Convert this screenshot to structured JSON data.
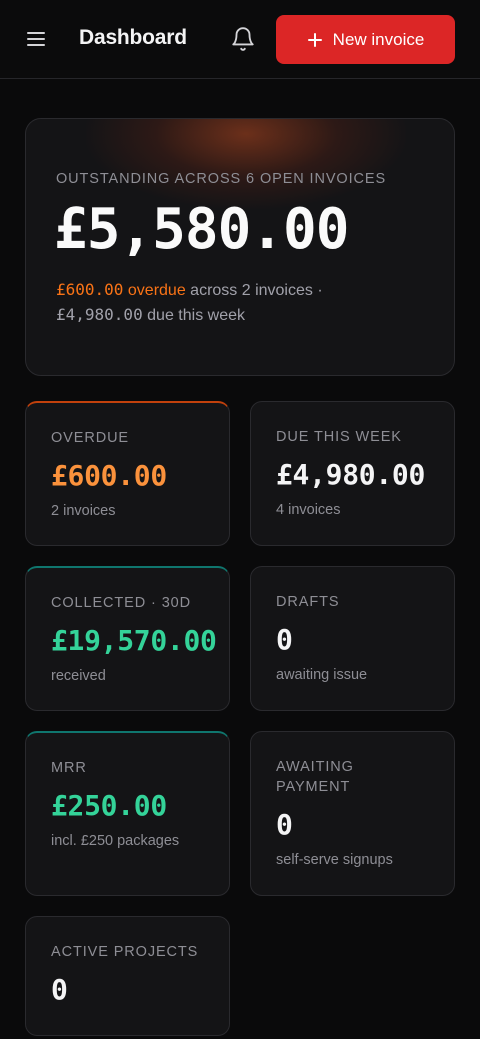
{
  "header": {
    "title": "Dashboard",
    "new_invoice_label": "New invoice",
    "accent": "#dc2626"
  },
  "hero": {
    "label": "OUTSTANDING ACROSS 6 OPEN INVOICES",
    "amount": "£5,580.00",
    "overdue_amount": "£600.00",
    "overdue_word": "overdue",
    "overdue_rest": " across 2 invoices ·",
    "due_amount": "£4,980.00",
    "due_rest": " due this week"
  },
  "cards": [
    {
      "label": "OVERDUE",
      "value": "£600.00",
      "sub": "2 invoices",
      "color": "#fb923c"
    },
    {
      "label": "DUE THIS WEEK",
      "value": "£4,980.00",
      "sub": "4 invoices"
    },
    {
      "label": "COLLECTED · 30D",
      "value": "£19,570.00",
      "sub": "received",
      "color": "#34d399"
    },
    {
      "label": "DRAFTS",
      "value": "0",
      "sub": "awaiting issue"
    },
    {
      "label": "MRR",
      "value": "£250.00",
      "sub": "incl. £250 packages",
      "color": "#34d399"
    },
    {
      "label": "AWAITING PAYMENT",
      "value": "0",
      "sub": "self-serve signups"
    },
    {
      "label": "ACTIVE PROJECTS",
      "value": "0"
    }
  ]
}
